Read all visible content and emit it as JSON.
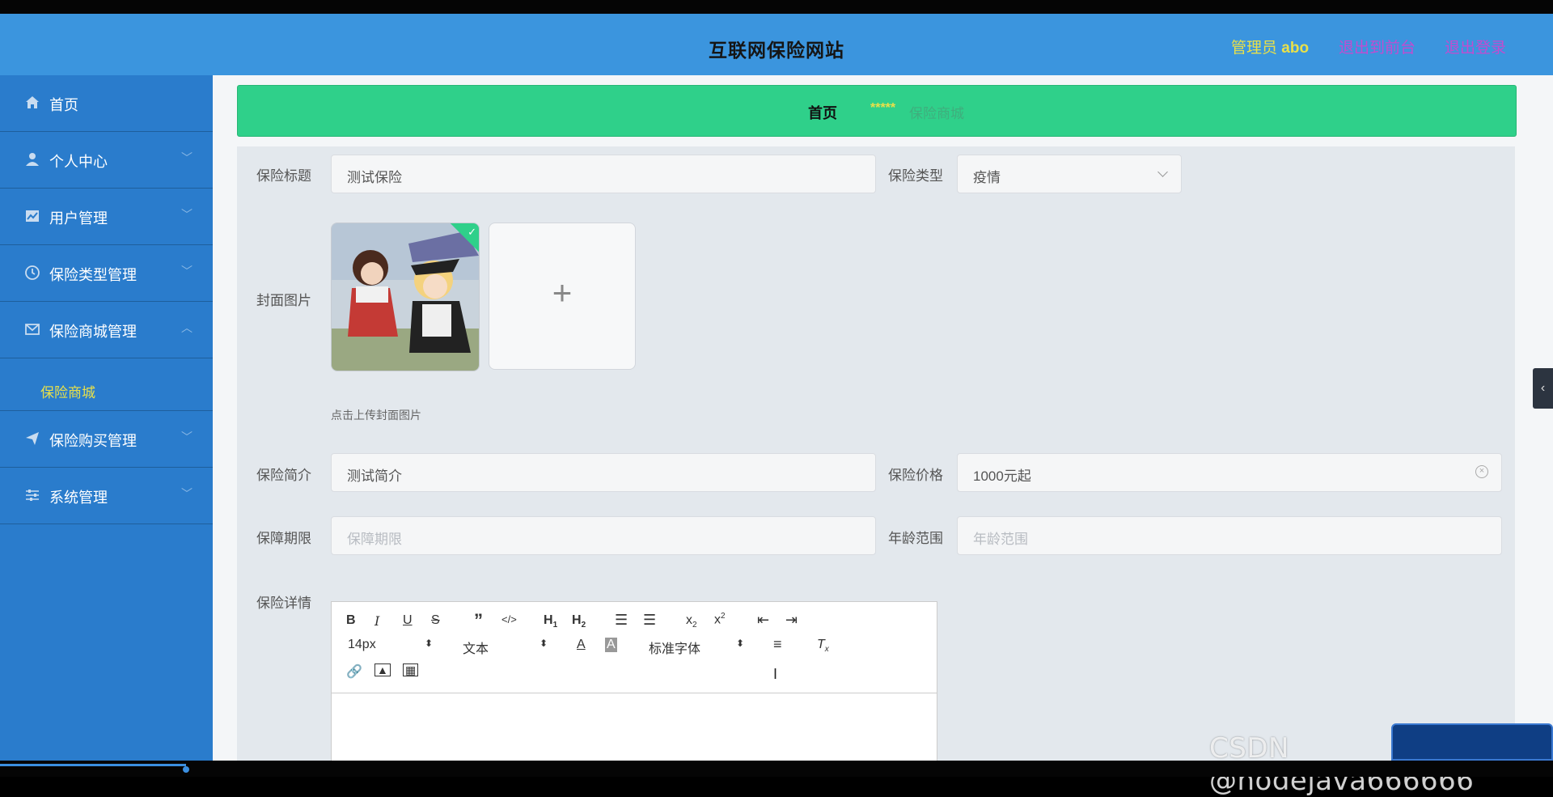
{
  "header": {
    "title": "互联网保险网站",
    "admin_prefix": "管理员",
    "admin_name": "abo",
    "link_front": "退出到前台",
    "link_logout": "退出登录",
    "bg_color": "#3b95de"
  },
  "sidebar": {
    "items": [
      {
        "label": "首页",
        "icon": "home-icon"
      },
      {
        "label": "个人中心",
        "icon": "user-icon"
      },
      {
        "label": "用户管理",
        "icon": "chart-icon"
      },
      {
        "label": "保险类型管理",
        "icon": "clock-icon"
      },
      {
        "label": "保险商城管理",
        "icon": "mail-icon"
      },
      {
        "label": "保险购买管理",
        "icon": "send-icon"
      },
      {
        "label": "系统管理",
        "icon": "sliders-icon"
      }
    ],
    "sub_active": "保险商城"
  },
  "breadcrumb": {
    "home": "首页",
    "stars": "*****",
    "current": "保险商城"
  },
  "form": {
    "title_label": "保险标题",
    "title_value": "测试保险",
    "type_label": "保险类型",
    "type_value": "疫情",
    "cover_label": "封面图片",
    "cover_hint": "点击上传封面图片",
    "intro_label": "保险简介",
    "intro_value": "测试简介",
    "price_label": "保险价格",
    "price_value": "1000元起",
    "period_label": "保障期限",
    "period_placeholder": "保障期限",
    "age_label": "年龄范围",
    "age_placeholder": "年龄范围",
    "detail_label": "保险详情"
  },
  "editor": {
    "font_size": "14px",
    "text_style": "文本",
    "font_family": "标准字体"
  },
  "watermark": "CSDN @nodejava666666"
}
